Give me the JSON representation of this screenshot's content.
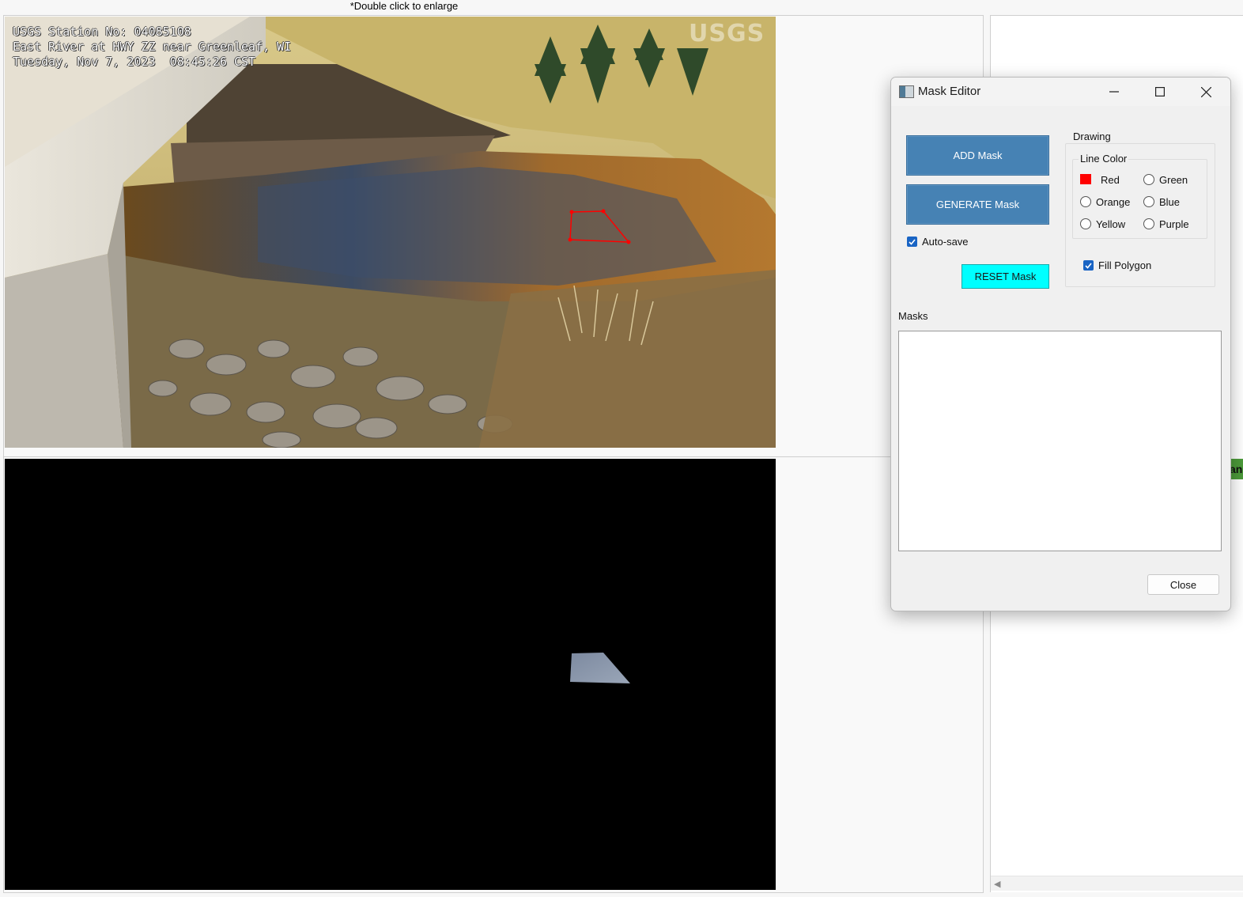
{
  "hint_text": "*Double click to enlarge",
  "camera_overlay": {
    "line1": "USGS Station No: 04085108",
    "line2": "East River at HWY ZZ near Greenleaf, WI",
    "line3": "Tuesday, Nov 7, 2023  08:45:26 CST",
    "logo": "USGS"
  },
  "right_panel": {
    "green_peek_text": "an"
  },
  "dialog": {
    "title": "Mask Editor",
    "add_mask_label": "ADD Mask",
    "generate_mask_label": "GENERATE Mask",
    "auto_save_label": "Auto-save",
    "auto_save_checked": true,
    "reset_mask_label": "RESET Mask",
    "drawing_group_label": "Drawing",
    "line_color_group_label": "Line Color",
    "colors": {
      "red": "Red",
      "green": "Green",
      "orange": "Orange",
      "blue": "Blue",
      "yellow": "Yellow",
      "purple": "Purple"
    },
    "selected_color": "Red",
    "fill_polygon_label": "Fill Polygon",
    "fill_polygon_checked": true,
    "masks_label": "Masks",
    "masks": [],
    "close_label": "Close"
  },
  "accent_colors": {
    "button_blue": "#4682b4",
    "reset_cyan": "#00ffff",
    "mask_line_red": "#ff0000",
    "checkbox_blue": "#1964c4"
  }
}
